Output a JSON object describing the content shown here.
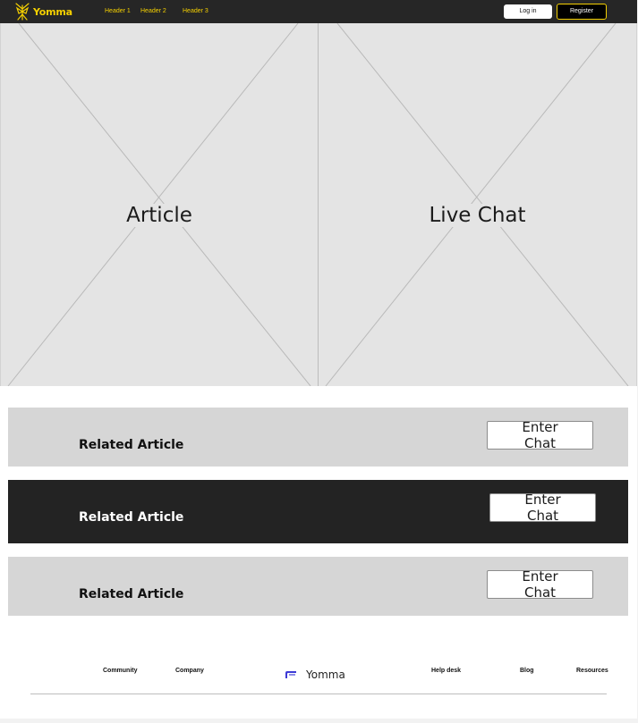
{
  "header": {
    "logo_text": "Yomma",
    "nav": [
      "Header 1",
      "Header 2",
      "Header 3"
    ],
    "login_label": "Log in",
    "register_label": "Register"
  },
  "panels": {
    "article_label": "Article",
    "chat_label": "Live Chat"
  },
  "related": [
    {
      "title": "Related Article",
      "button_line1": "Enter",
      "button_line2": "Chat",
      "style": "light"
    },
    {
      "title": "Related Article",
      "button_line1": "Enter",
      "button_line2": "Chat",
      "style": "dark"
    },
    {
      "title": "Related Article",
      "button_line1": "Enter",
      "button_line2": "Chat",
      "style": "light"
    }
  ],
  "footer": {
    "links_left": [
      "Community",
      "Company"
    ],
    "logo_text": "Yomma",
    "links_right": [
      "Help desk",
      "Blog",
      "Resources"
    ]
  },
  "colors": {
    "brand_yellow": "#f5d000",
    "navbar_bg": "#262626",
    "placeholder_bg": "#e4e4e4",
    "row_light": "#d6d6d6",
    "row_dark": "#232323",
    "footer_logo_blue": "#3d3bd6"
  },
  "icons": {
    "logo": "yomma-butterfly-icon",
    "footer_logo": "yomma-mark-icon",
    "placeholder": "image-placeholder-cross"
  }
}
